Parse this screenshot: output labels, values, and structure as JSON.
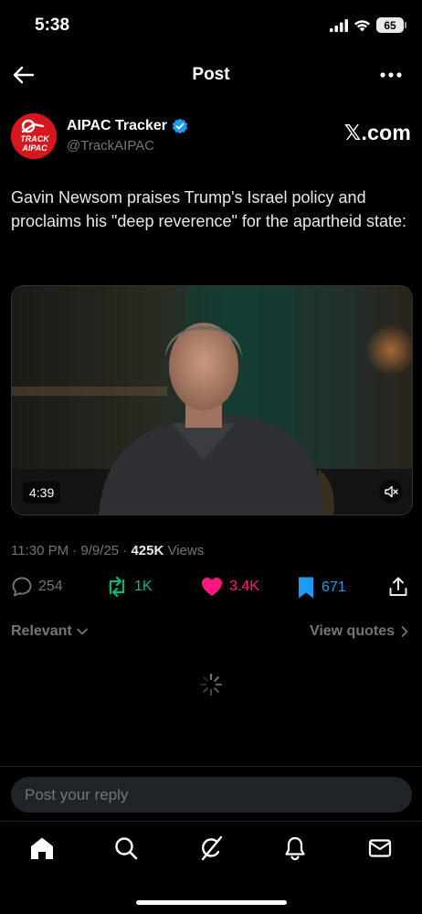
{
  "status_bar": {
    "time": "5:38",
    "battery": "65"
  },
  "header": {
    "title": "Post"
  },
  "author": {
    "name": "AIPAC Tracker",
    "handle": "@TrackAIPAC",
    "avatar_text_1": "TRACK",
    "avatar_text_2": "AIPAC",
    "site": "𝕏.com"
  },
  "post": {
    "text": "Gavin Newsom praises Trump's Israel policy and proclaims his \"deep reverence\" for the apartheid state:",
    "video_duration": "4:39",
    "timestamp": "11:30 PM · 9/9/25 · ",
    "views_count": "425K",
    "views_label": " Views"
  },
  "actions": {
    "replies": "254",
    "reposts": "1K",
    "likes": "3.4K",
    "bookmarks": "671"
  },
  "replies_section": {
    "sort_label": "Relevant",
    "view_quotes_label": "View quotes"
  },
  "composer": {
    "placeholder": "Post your reply"
  },
  "colors": {
    "repost_green": "#00ba7c",
    "like_pink": "#f91880",
    "bookmark_blue": "#1d9bf0",
    "verified_blue": "#1d9bf0",
    "muted_gray": "#71767b"
  },
  "icons": {
    "back": "arrow-left-icon",
    "more": "more-horizontal-icon",
    "reply": "reply-bubble-icon",
    "repost": "repost-icon",
    "like": "heart-filled-icon",
    "bookmark": "bookmark-filled-icon",
    "share": "share-icon",
    "mute": "speaker-muted-icon",
    "tabs": [
      "home-icon",
      "search-icon",
      "grok-icon",
      "bell-icon",
      "mail-icon"
    ]
  }
}
